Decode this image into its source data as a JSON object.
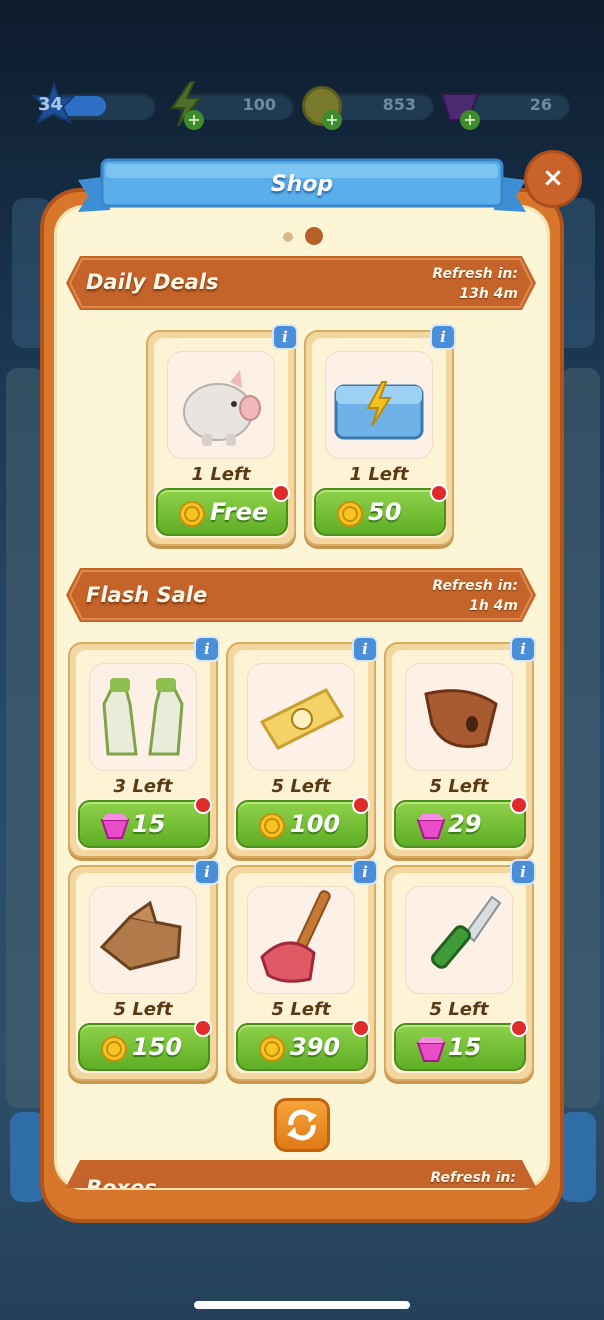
{
  "status_bar": {
    "level": "34",
    "energy": "100",
    "coins": "853",
    "gems": "26"
  },
  "shop": {
    "title": "Shop",
    "close_label": "×"
  },
  "daily_deals": {
    "title": "Daily Deals",
    "refresh_label": "Refresh in:",
    "refresh_time": "13h 4m",
    "items": [
      {
        "icon": "piggy-bank",
        "left": "1 Left",
        "price": "Free",
        "currency": "coin"
      },
      {
        "icon": "energy-chest",
        "left": "1 Left",
        "price": "50",
        "currency": "coin"
      }
    ]
  },
  "flash_sale": {
    "title": "Flash Sale",
    "refresh_label": "Refresh in:",
    "refresh_time": "1h 4m",
    "items": [
      {
        "icon": "garden-gloves",
        "left": "3 Left",
        "price": "15",
        "currency": "gem"
      },
      {
        "icon": "seed-packet",
        "left": "5 Left",
        "price": "100",
        "currency": "coin"
      },
      {
        "icon": "clay-scoop",
        "left": "5 Left",
        "price": "29",
        "currency": "gem"
      },
      {
        "icon": "leather-gloves",
        "left": "5 Left",
        "price": "150",
        "currency": "coin"
      },
      {
        "icon": "plunger",
        "left": "5 Left",
        "price": "390",
        "currency": "coin"
      },
      {
        "icon": "knife",
        "left": "5 Left",
        "price": "15",
        "currency": "gem"
      }
    ]
  },
  "boxes": {
    "title": "Boxes",
    "refresh_label": "Refresh in:"
  },
  "colors": {
    "accent_orange": "#d8772c",
    "button_green": "#6cbc30",
    "panel_cream": "#fdf6d6",
    "info_blue": "#4a8ed8"
  }
}
